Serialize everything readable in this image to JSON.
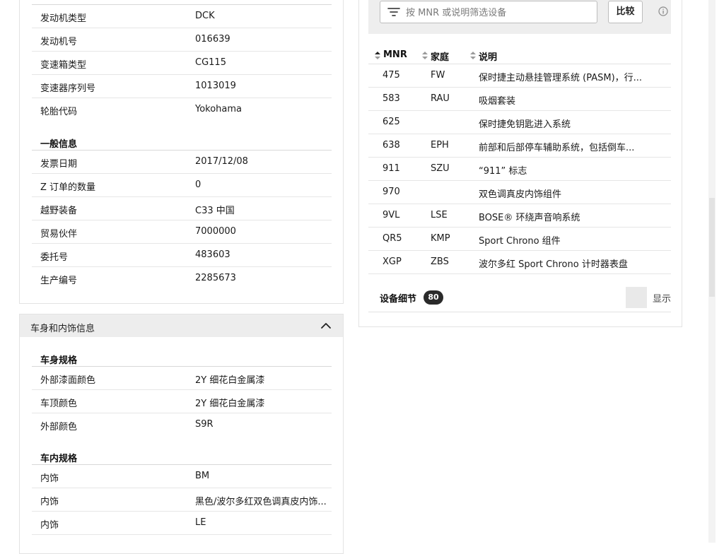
{
  "vehicle_section": {
    "rows_top": [
      {
        "key": "发动机类型",
        "value": "DCK"
      },
      {
        "key": "发动机号",
        "value": "016639"
      },
      {
        "key": "变速箱类型",
        "value": "CG115"
      },
      {
        "key": "变速器序列号",
        "value": "1013019"
      },
      {
        "key": "轮胎代码",
        "value": "Yokohama"
      }
    ],
    "general_title": "一般信息",
    "rows_general": [
      {
        "key": "发票日期",
        "value": "2017/12/08"
      },
      {
        "key": "Z 订单的数量",
        "value": "0"
      },
      {
        "key": "越野装备",
        "value": "C33 中国"
      },
      {
        "key": "贸易伙伴",
        "value": "7000000"
      },
      {
        "key": "委托号",
        "value": "483603"
      },
      {
        "key": "生产编号",
        "value": "2285673"
      }
    ]
  },
  "body_section": {
    "header": "车身和内饰信息",
    "body_title": "车身规格",
    "rows_body": [
      {
        "key": "外部漆面颜色",
        "value": "2Y 细花白金属漆"
      },
      {
        "key": "车顶颜色",
        "value": "2Y 细花白金属漆"
      },
      {
        "key": "外部颜色",
        "value": "S9R"
      }
    ],
    "interior_title": "车内规格",
    "rows_interior": [
      {
        "key": "内饰",
        "value": "BM"
      },
      {
        "key": "内饰",
        "value": "黑色/波尔多红双色调真皮内饰..."
      },
      {
        "key": "内饰",
        "value": "LE"
      }
    ]
  },
  "equipment": {
    "search_placeholder": "按 MNR 或说明筛选设备",
    "compare_label": "比较",
    "columns": {
      "mnr": "MNR",
      "family": "家庭",
      "desc": "说明"
    },
    "rows": [
      {
        "mnr": "475",
        "family": "FW",
        "desc": "保时捷主动悬挂管理系统 (PASM)，行..."
      },
      {
        "mnr": "583",
        "family": "RAU",
        "desc": "吸烟套装"
      },
      {
        "mnr": "625",
        "family": "",
        "desc": "保时捷免钥匙进入系统"
      },
      {
        "mnr": "638",
        "family": "EPH",
        "desc": "前部和后部停车辅助系统，包括倒车..."
      },
      {
        "mnr": "911",
        "family": "SZU",
        "desc": "“911” 标志"
      },
      {
        "mnr": "970",
        "family": "",
        "desc": "双色调真皮内饰组件"
      },
      {
        "mnr": "9VL",
        "family": "LSE",
        "desc": "BOSE® 环绕声音响系统"
      },
      {
        "mnr": "QR5",
        "family": "KMP",
        "desc": "Sport Chrono 组件"
      },
      {
        "mnr": "XGP",
        "family": "ZBS",
        "desc": "波尔多红 Sport Chrono 计时器表盘"
      }
    ],
    "details_label": "设备细节",
    "details_count": "80",
    "show_label": "显示"
  }
}
